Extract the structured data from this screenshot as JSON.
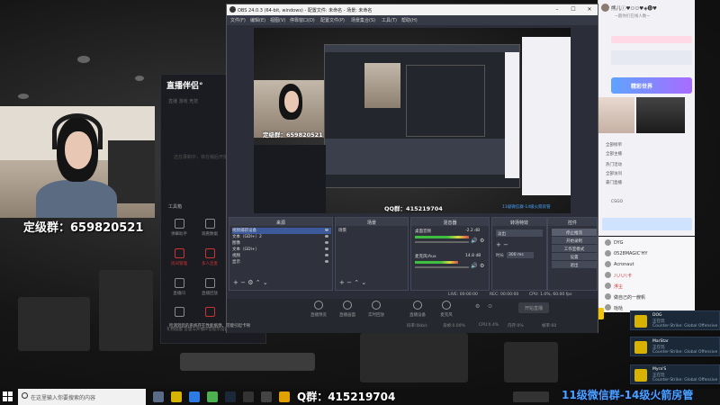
{
  "webcam": {
    "caption": "定级群：659820521"
  },
  "companion": {
    "title": "直播伴侣°",
    "tabs": "直播  游戏  竞技",
    "hint": "还在录制中，将在稍后开播",
    "section": "工具箱",
    "tools": [
      {
        "label": "弹幕助手"
      },
      {
        "label": "观看数据"
      },
      {
        "label": "房间管理"
      },
      {
        "label": "多人连麦"
      },
      {
        "label": "直播间"
      },
      {
        "label": "直播回放"
      },
      {
        "label": ""
      },
      {
        "label": ""
      },
      {
        "label": ""
      }
    ],
    "footer": "礼物提醒  音量与开播声音提示设置中，敬请期待"
  },
  "chat": {
    "room_title": "熊儿ⓘ♥⚇⚇♥◈🅓♥",
    "room_sub": "~圆你们在线人数~",
    "banner": "精彩世界",
    "lines": [
      "全部榜单",
      "全部主播",
      "热门活动",
      "全部访问",
      "豪门直播",
      "CSGO"
    ]
  },
  "viewers": [
    {
      "name": "DYG"
    },
    {
      "name": "0528MAGIC'HY"
    },
    {
      "name": "Acronaut"
    },
    {
      "name": "八八八卡"
    },
    {
      "name": "浮尘"
    },
    {
      "name": "做自己的一艘帆"
    },
    {
      "name": "哒哒"
    }
  ],
  "send_label": "发送",
  "notifications": [
    {
      "name": "DOG",
      "status": "正在玩",
      "game": "Counter-Strike: Global Offensive"
    },
    {
      "name": "MarStar",
      "status": "正在玩",
      "game": "Counter-Strike: Global Offensive"
    },
    {
      "name": "Myra'S",
      "status": "正在玩",
      "game": "Counter-Strike: Global Offensive"
    }
  ],
  "obs": {
    "title": "OBS 24.0.3 (64-bit, windows) - 配置文件: 未命名 - 场景: 未命名",
    "menu": [
      "文件(F)",
      "编辑(E)",
      "视图(V)",
      "停靠窗口(D)",
      "配置文件(P)",
      "场景集合(S)",
      "工具(T)",
      "帮助(H)"
    ],
    "preview_caption_cam": "定级群：659820521",
    "preview_caption_main": "QQ群：415219704",
    "preview_caption_tray": "11级微信群-14级火箭房管",
    "docks": {
      "scenes": {
        "header": "场景",
        "items": [
          "场景"
        ]
      },
      "sources": {
        "header": "来源",
        "items": [
          "视频捕获设备",
          "文本（GDI+）2",
          "图像",
          "文本（GDI+）",
          "视频",
          "显示"
        ]
      },
      "mixer": {
        "header": "混音器",
        "rows": [
          {
            "label": "桌面音频",
            "db": "-2.2 dB"
          },
          {
            "label": "麦克风/Aux",
            "db": "14.8 dB"
          }
        ]
      },
      "transitions": {
        "header": "转场特效",
        "type": "淡出",
        "duration_label": "时长",
        "duration": "300 ms"
      },
      "controls": {
        "header": "控件",
        "buttons": [
          "停止推流",
          "开始录制",
          "工作室模式",
          "设置",
          "退出"
        ]
      }
    },
    "status": {
      "live": "LIVE: 00:00:00",
      "rec": "REC: 00:00:00",
      "cpu": "CPU: 1.0%, 60.00 fps"
    },
    "bottom_tools": [
      "直播预览",
      "直播画面",
      "实时回放",
      "直播设备",
      "麦克风"
    ],
    "start_live": "开始直播",
    "bottom_stats": [
      "码率:0kb/s",
      "丢帧:0.00%",
      "CPU:0.4%",
      "内存:0%",
      "帧率:60"
    ],
    "warning": "检测到您的系统存在性能瓶颈，可能引起卡顿"
  },
  "taskbar": {
    "search_placeholder": "在这里输入你要搜索的内容",
    "caption": "Q群：415219704",
    "tray_caption": "11级微信群-14级火箭房管"
  }
}
